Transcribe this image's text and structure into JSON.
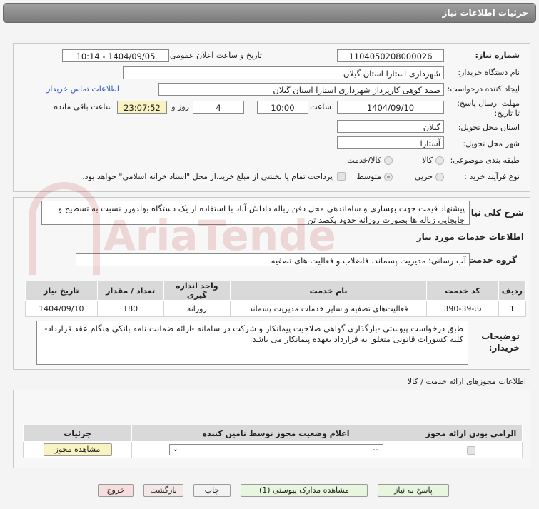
{
  "window": {
    "title": "جزئیات اطلاعات نیاز"
  },
  "watermark": {
    "text": "AriaTender.net"
  },
  "fields": {
    "need_number_label": "شماره نیاز:",
    "need_number": "1104050208000026",
    "announce_label": "تاریخ و ساعت اعلان عمومی:",
    "announce_value": "1404/09/05 - 10:14",
    "buyer_org_label": "نام دستگاه خریدار:",
    "buyer_org": "شهرداری استارا استان گیلان",
    "creator_label": "ایجاد کننده درخواست:",
    "creator": "صمد کوهی کارپرداز شهرداری استارا استان گیلان",
    "contact_link": "اطلاعات تماس خریدار",
    "deadline_label": "مهلت ارسال پاسخ: تا تاریخ:",
    "deadline_date": "1404/09/10",
    "time_label": "ساعت",
    "deadline_time": "10:00",
    "days_value": "4",
    "days_label": "روز و",
    "remaining_time": "23:07:52",
    "remaining_label": "ساعت باقی مانده",
    "province_label": "استان محل تحویل:",
    "province": "گیلان",
    "city_label": "شهر محل تحویل:",
    "city": "آستارا",
    "category_label": "طبقه بندی موضوعی:",
    "category_options": [
      "کالا",
      "کالا/خدمت"
    ],
    "process_label": "نوع فرآیند خرید :",
    "process_options": [
      "جزیی",
      "متوسط"
    ],
    "payment_note": "پرداخت تمام یا بخشی از مبلغ خرید،از محل \"اسناد خزانه اسلامی\" خواهد بود."
  },
  "summary": {
    "label": "شرح کلی نیاز:",
    "text": "پیشنهاد قیمت جهت بهسازی و ساماندهی محل دفن زباله داداش آباد با استفاده از یک دستگاه بولدوزر نسبت به تسطیح و جابجایی زباله ها بصورت روزانه حدود یکصد تن"
  },
  "services": {
    "heading": "اطلاعات خدمات مورد نیاز",
    "group_label": "گروه خدمت:",
    "group_value": "آب رسانی؛ مدیریت پسماند، فاضلاب و فعالیت های تصفیه",
    "columns": [
      "ردیف",
      "کد خدمت",
      "نام خدمت",
      "واحد اندازه گیری",
      "تعداد / مقدار",
      "تاریخ نیاز"
    ],
    "rows": [
      [
        "1",
        "ث-39-390",
        "فعالیت‌های تصفیه و سایر خدمات مدیریت پسماند",
        "روزانه",
        "180",
        "1404/09/10"
      ]
    ]
  },
  "buyer_notes": {
    "label": "توضیحات خریدار:",
    "text": "طبق درخواست پیوستی -بارگذاری گواهی صلاحیت پیمانکار و شرکت در سامانه -ارائه ضمانت نامه بانکی هنگام عقد قرارداد- کلیه کسورات قانونی متعلق به قرارداد بعهده پیمانکار می باشد."
  },
  "permits": {
    "heading": "اطلاعات مجوزهای ارائه خدمت / کالا",
    "columns": [
      "الزامی بودن ارائه مجوز",
      "اعلام وضعیت مجوز توسط تامین کننده",
      "جزئیات"
    ],
    "select_value": "--",
    "view_button": "مشاهده مجوز"
  },
  "buttons": {
    "reply": "پاسخ به نیاز",
    "attachments": "مشاهده مدارک پیوستی (1)",
    "print": "چاپ",
    "back": "بازگشت",
    "exit": "خروج"
  }
}
